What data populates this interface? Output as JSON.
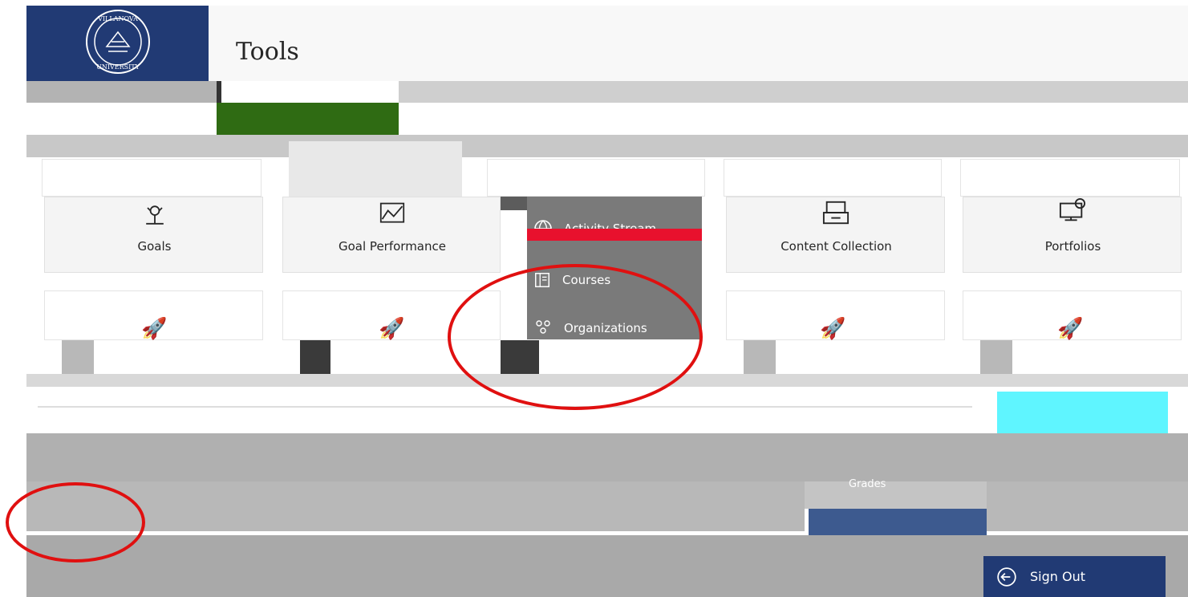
{
  "header": {
    "title": "Tools",
    "logo_alt": "Villanova University"
  },
  "dropdown": {
    "items": [
      {
        "label": "Activity Stream",
        "icon": "globe-icon"
      },
      {
        "label": "Courses",
        "icon": "courses-icon"
      },
      {
        "label": "Organizations",
        "icon": "organizations-icon"
      }
    ]
  },
  "tools": {
    "row1": [
      {
        "label": "Goals",
        "icon": "goals-icon"
      },
      {
        "label": "Goal Performance",
        "icon": "goal-performance-icon"
      },
      {
        "label": "",
        "icon": "tool-icon"
      },
      {
        "label": "Content Collection",
        "icon": "content-collection-icon"
      },
      {
        "label": "Portfolios",
        "icon": "portfolios-icon"
      }
    ],
    "row2": [
      {
        "icon": "rocket-icon"
      },
      {
        "icon": "rocket-icon"
      },
      {
        "icon": "rocket-icon"
      },
      {
        "icon": "rocket-icon"
      },
      {
        "icon": "rocket-icon"
      }
    ]
  },
  "sidebar": {
    "sign_out": "Sign Out",
    "grades": "Grades"
  },
  "colors": {
    "brand_navy": "#213a74",
    "annotation_red": "#e01010",
    "menu_gray": "#7a7a7a",
    "accent_red": "#e8112d"
  }
}
